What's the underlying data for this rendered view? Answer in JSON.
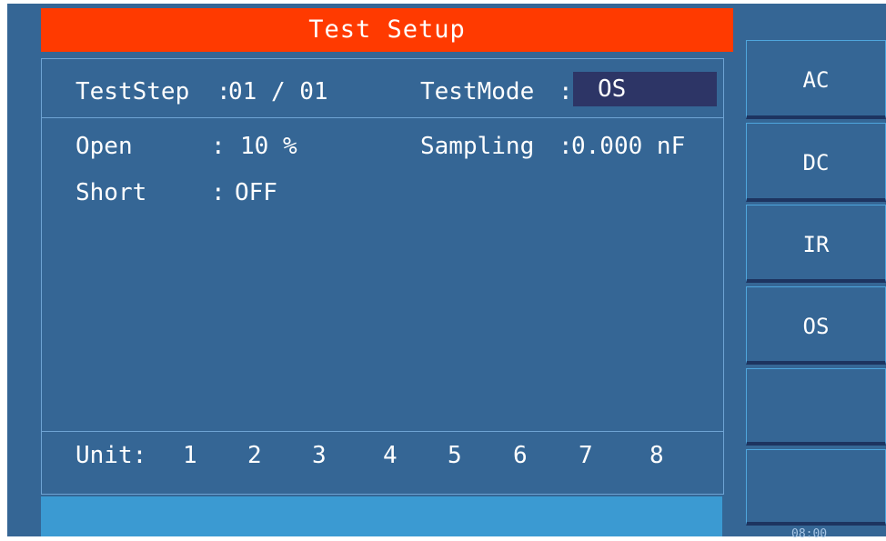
{
  "title": "Test Setup",
  "test_step": {
    "label": "TestStep",
    "sep": ":",
    "value": "01 / 01"
  },
  "test_mode": {
    "label": "TestMode",
    "sep": ":",
    "value": "OS"
  },
  "open": {
    "label": "Open",
    "sep": ":",
    "value": "10 %"
  },
  "sampling": {
    "label": "Sampling",
    "sep": ":",
    "value": "0.000 nF"
  },
  "short": {
    "label": "Short",
    "sep": ":",
    "value": "OFF"
  },
  "unit": {
    "label": "Unit:",
    "values": [
      "1",
      "2",
      "3",
      "4",
      "5",
      "6",
      "7",
      "8"
    ]
  },
  "softkeys": [
    "AC",
    "DC",
    "IR",
    "OS",
    "",
    ""
  ],
  "clock": "08:00"
}
